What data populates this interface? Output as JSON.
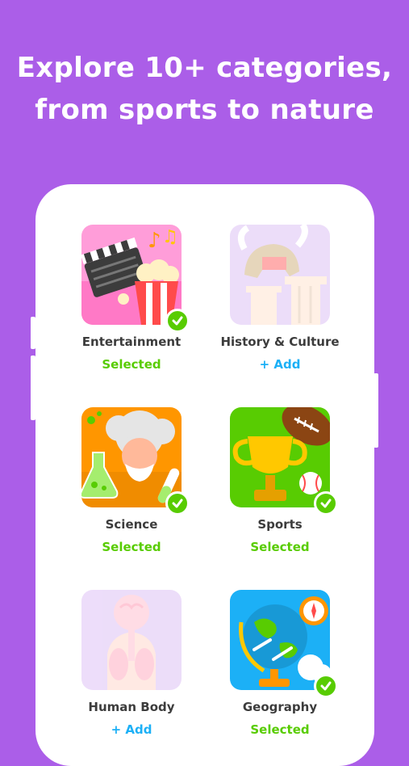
{
  "headline": {
    "line1": "Explore 10+ categories,",
    "line2": "from sports to nature"
  },
  "colors": {
    "background": "#ab5ee8",
    "selected": "#58cc02",
    "add": "#1cb0f6"
  },
  "categories": [
    {
      "name": "Entertainment",
      "status": "Selected",
      "icon": "clapperboard-popcorn-icon"
    },
    {
      "name": "History & Culture",
      "status": "+ Add",
      "icon": "helmet-columns-icon"
    },
    {
      "name": "Science",
      "status": "Selected",
      "icon": "scientist-flask-icon"
    },
    {
      "name": "Sports",
      "status": "Selected",
      "icon": "trophy-football-icon"
    },
    {
      "name": "Human Body",
      "status": "+ Add",
      "icon": "anatomy-body-icon"
    },
    {
      "name": "Geography",
      "status": "Selected",
      "icon": "globe-compass-icon"
    }
  ]
}
